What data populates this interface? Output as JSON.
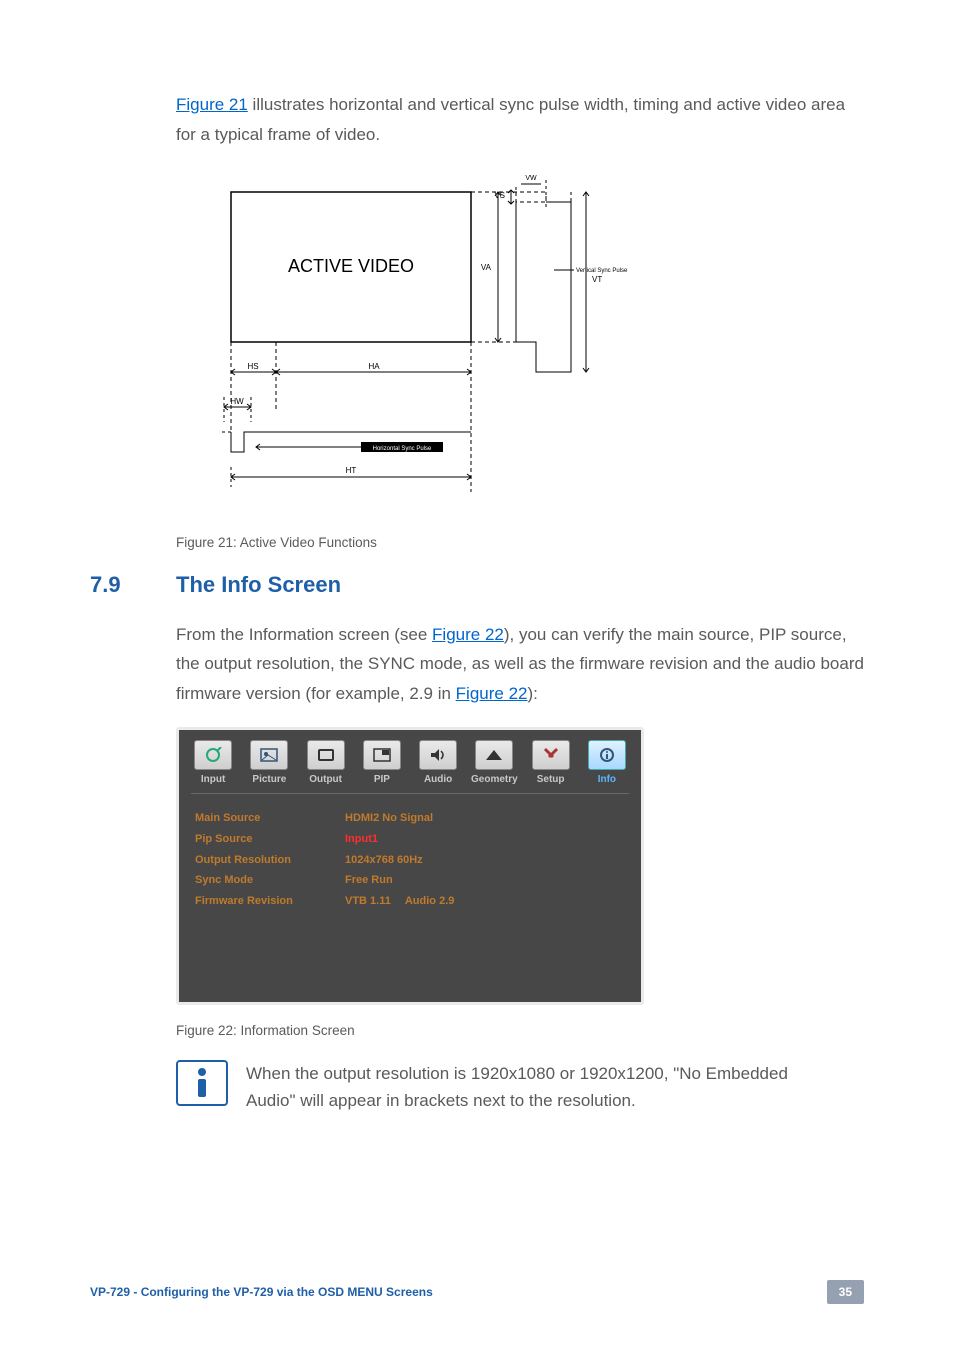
{
  "intro_prefix": "Figure 21",
  "intro_rest": " illustrates horizontal and vertical sync pulse width, timing and active video area for a typical frame of video.",
  "diagram": {
    "active_video": "ACTIVE VIDEO",
    "vw": "VW",
    "vs": "VS",
    "vt": "VT",
    "va": "VA",
    "vsp": "Vertical Sync Pulse",
    "hs": "HS",
    "hw": "HW",
    "ha": "HA",
    "ht": "HT",
    "hsp": "Horizontal Sync Pulse"
  },
  "caption21": "Figure 21: Active Video Functions",
  "section": {
    "num": "7.9",
    "title": "The Info Screen"
  },
  "info_para_pre": "From the Information screen (see ",
  "info_para_link1": "Figure 22",
  "info_para_mid": "), you can verify the main source, PIP source, the output resolution, the SYNC mode, as well as the firmware revision and the audio board firmware version (for example, 2.9 in ",
  "info_para_link2": "Figure 22",
  "info_para_end": "):",
  "osd": {
    "tabs": [
      "Input",
      "Picture",
      "Output",
      "PIP",
      "Audio",
      "Geometry",
      "Setup",
      "Info"
    ],
    "rows": [
      {
        "label": "Main Source",
        "value": "HDMI2 No Signal",
        "hl": false
      },
      {
        "label": "Pip Source",
        "value": "Input1",
        "hl": true
      },
      {
        "label": "Output Resolution",
        "value": "1024x768 60Hz",
        "hl": false
      },
      {
        "label": "Sync Mode",
        "value": "Free Run",
        "hl": false
      },
      {
        "label": "Firmware Revision",
        "value": "VTB 1.11",
        "value2": "Audio 2.9",
        "hl": false
      }
    ]
  },
  "caption22": "Figure 22: Information Screen",
  "note": "When the output resolution is 1920x1080 or 1920x1200, \"No Embedded Audio\" will appear in brackets next to the resolution.",
  "footer": {
    "left": "VP-729 - Configuring the VP-729 via the OSD MENU Screens",
    "page": "35"
  }
}
